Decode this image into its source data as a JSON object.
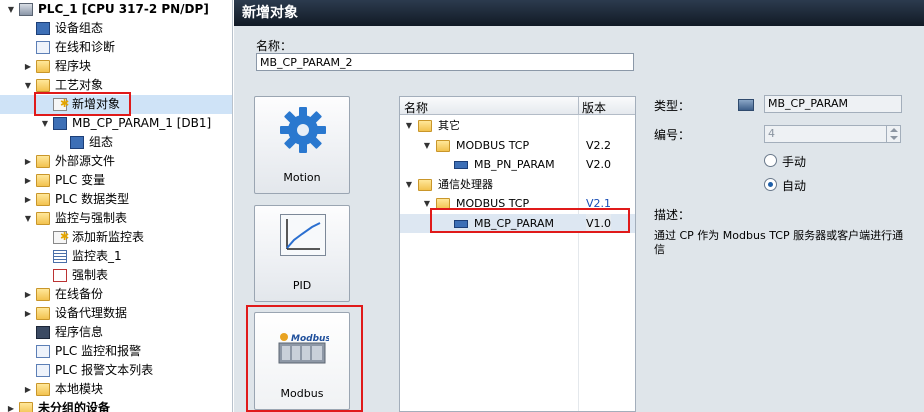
{
  "tree": {
    "items": [
      {
        "label": "PLC_1 [CPU 317-2 PN/DP]",
        "icon": "cpu-icon",
        "arrow": "▼",
        "indent": 0,
        "bold": true
      },
      {
        "label": "设备组态",
        "icon": "device-config-icon",
        "arrow": "",
        "indent": 1
      },
      {
        "label": "在线和诊断",
        "icon": "online-diagnostics-icon",
        "arrow": "",
        "indent": 1
      },
      {
        "label": "程序块",
        "icon": "folder-icon",
        "arrow": "▶",
        "indent": 1
      },
      {
        "label": "工艺对象",
        "icon": "folder-icon",
        "arrow": "▼",
        "indent": 1
      },
      {
        "label": "新增对象",
        "icon": "add-object-icon",
        "arrow": "",
        "indent": 2,
        "selected": true
      },
      {
        "label": "MB_CP_PARAM_1 [DB1]",
        "icon": "db-icon",
        "arrow": "▼",
        "indent": 2
      },
      {
        "label": "组态",
        "icon": "config-icon",
        "arrow": "",
        "indent": 3
      },
      {
        "label": "外部源文件",
        "icon": "folder-icon",
        "arrow": "▶",
        "indent": 1
      },
      {
        "label": "PLC 变量",
        "icon": "folder-icon",
        "arrow": "▶",
        "indent": 1
      },
      {
        "label": "PLC 数据类型",
        "icon": "folder-icon",
        "arrow": "▶",
        "indent": 1
      },
      {
        "label": "监控与强制表",
        "icon": "folder-icon",
        "arrow": "▼",
        "indent": 1
      },
      {
        "label": "添加新监控表",
        "icon": "add-watch-table-icon",
        "arrow": "",
        "indent": 2
      },
      {
        "label": "监控表_1",
        "icon": "watch-table-icon",
        "arrow": "",
        "indent": 2
      },
      {
        "label": "强制表",
        "icon": "force-table-icon",
        "arrow": "",
        "indent": 2
      },
      {
        "label": "在线备份",
        "icon": "folder-icon",
        "arrow": "▶",
        "indent": 1
      },
      {
        "label": "设备代理数据",
        "icon": "folder-icon",
        "arrow": "▶",
        "indent": 1
      },
      {
        "label": "程序信息",
        "icon": "program-info-icon",
        "arrow": "",
        "indent": 1
      },
      {
        "label": "PLC 监控和报警",
        "icon": "plc-alarm-icon",
        "arrow": "",
        "indent": 1
      },
      {
        "label": "PLC 报警文本列表",
        "icon": "alarm-text-icon",
        "arrow": "",
        "indent": 1
      },
      {
        "label": "本地模块",
        "icon": "folder-icon",
        "arrow": "▶",
        "indent": 1
      },
      {
        "label": "未分组的设备",
        "icon": "folder-icon",
        "arrow": "▶",
        "indent": 0,
        "bold": true
      }
    ]
  },
  "dialog": {
    "title": "新增对象",
    "name_label": "名称：",
    "name_value": "MB_CP_PARAM_2",
    "categories": [
      {
        "label": "Motion",
        "icon": "gear-icon"
      },
      {
        "label": "PID",
        "icon": "pid-curve-icon"
      },
      {
        "label": "Modbus",
        "icon": "modbus-icon",
        "icon_text": "Modbus"
      }
    ],
    "list": {
      "col_name": "名称",
      "col_version": "版本",
      "rows": [
        {
          "label": "其它",
          "version": "",
          "arrow": "▼",
          "icon": "folder-icon",
          "indent": 0
        },
        {
          "label": "MODBUS TCP",
          "version": "V2.2",
          "arrow": "▼",
          "icon": "folder-icon",
          "indent": 1
        },
        {
          "label": "MB_PN_PARAM",
          "version": "V2.0",
          "arrow": "",
          "icon": "block-icon",
          "indent": 2
        },
        {
          "label": "通信处理器",
          "version": "",
          "arrow": "▼",
          "icon": "folder-icon",
          "indent": 0
        },
        {
          "label": "MODBUS TCP",
          "version": "V2.1",
          "arrow": "▼",
          "icon": "folder-icon",
          "indent": 1,
          "link": true
        },
        {
          "label": "MB_CP_PARAM",
          "version": "V1.0",
          "arrow": "",
          "icon": "block-icon",
          "indent": 2,
          "selected": true
        }
      ]
    },
    "props": {
      "type_label": "类型：",
      "type_value": "MB_CP_PARAM",
      "number_label": "编号：",
      "number_value": "4",
      "radio_manual": "手动",
      "radio_auto": "自动",
      "radio_selected": "auto",
      "desc_label": "描述：",
      "desc_text": "通过 CP 作为 Modbus TCP 服务器或客户端进行通信"
    }
  }
}
